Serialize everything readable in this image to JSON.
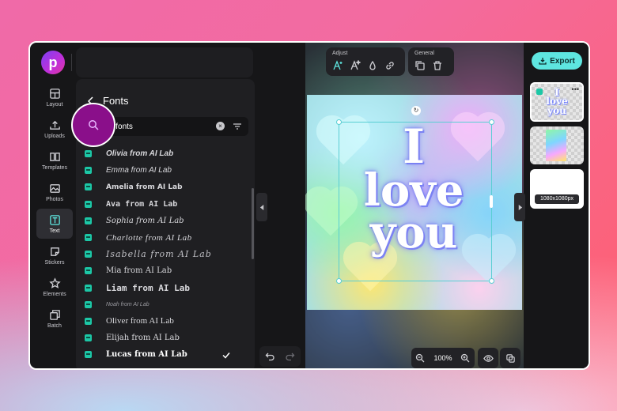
{
  "app": {
    "logo_letter": "p",
    "accent": "#5ee6e0",
    "brand": "#c22fd8"
  },
  "leftnav": {
    "items": [
      {
        "label": "Layout",
        "icon": "layout-icon"
      },
      {
        "label": "Uploads",
        "icon": "upload-icon"
      },
      {
        "label": "Templates",
        "icon": "book-icon"
      },
      {
        "label": "Photos",
        "icon": "image-icon"
      },
      {
        "label": "Text",
        "icon": "text-icon",
        "active": true
      },
      {
        "label": "Stickers",
        "icon": "sticker-icon"
      },
      {
        "label": "Elements",
        "icon": "star-icon"
      },
      {
        "label": "Batch",
        "icon": "batch-icon"
      }
    ]
  },
  "panel": {
    "title": "Fonts",
    "search": {
      "value": "AI fonts",
      "placeholder": ""
    },
    "fonts": [
      "Olivia from AI Lab",
      "Emma from AI Lab",
      "Amelia from AI Lab",
      "Ava from AI Lab",
      "Sophia from AI Lab",
      "Charlotte from AI Lab",
      "Isabella from AI Lab",
      "Mia from AI Lab",
      "Liam from AI Lab",
      "Noah from AI Lab",
      "Oliver from AI Lab",
      "Elijah from AI Lab",
      "Lucas from AI Lab"
    ],
    "selected_index": 12
  },
  "toolbar": {
    "adjust_label": "Adjust",
    "general_label": "General"
  },
  "canvas": {
    "text_line1": "I",
    "text_line2": "love",
    "text_line3": "you"
  },
  "zoom": {
    "value": "100%"
  },
  "export": {
    "label": "Export"
  },
  "pages": {
    "thumb_text_1": "I",
    "thumb_text_2": "love",
    "thumb_text_3": "you",
    "size_label": "1080x1080px"
  }
}
